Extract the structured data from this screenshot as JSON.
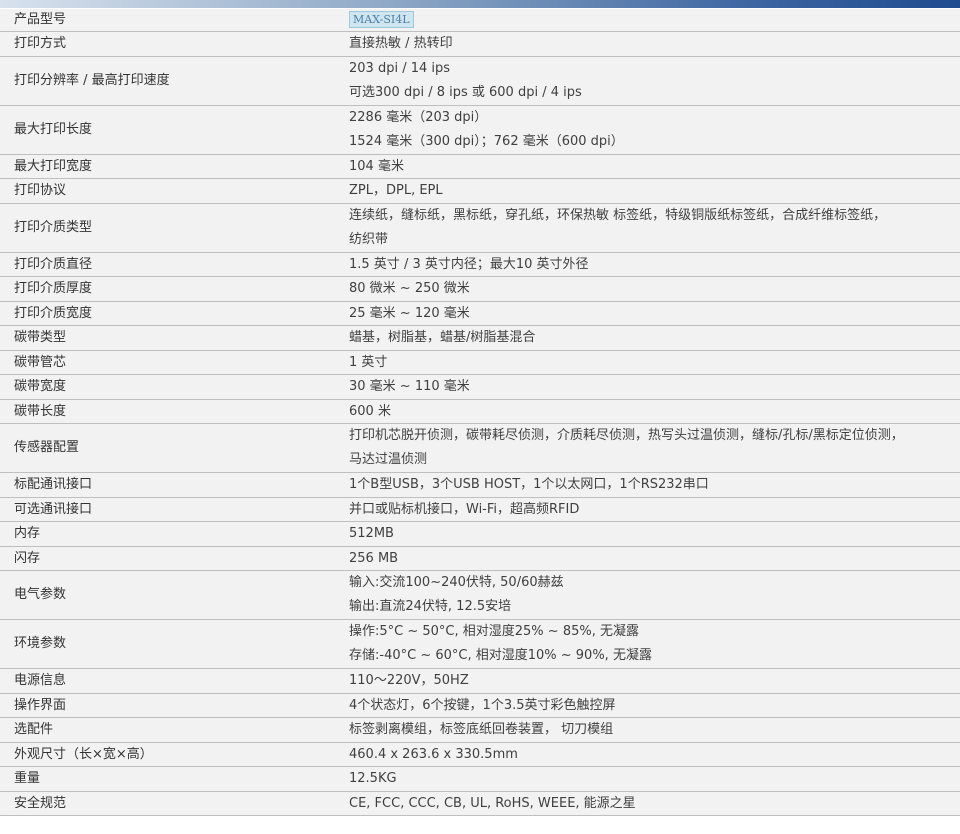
{
  "model_badge": "MAX-SI4L",
  "rows": [
    {
      "label": "产品型号",
      "lines": []
    },
    {
      "label": "打印方式",
      "lines": [
        "直接热敏 / 热转印"
      ]
    },
    {
      "label": "打印分辨率 / 最高打印速度",
      "lines": [
        "203 dpi / 14 ips",
        "可选300 dpi / 8 ips 或 600 dpi / 4 ips"
      ]
    },
    {
      "label": "最大打印长度",
      "lines": [
        "2286 毫米（203 dpi）",
        "1524 毫米（300 dpi）；762 毫米（600 dpi）"
      ]
    },
    {
      "label": "最大打印宽度",
      "lines": [
        "104 毫米"
      ]
    },
    {
      "label": "打印协议",
      "lines": [
        "ZPL，DPL, EPL"
      ]
    },
    {
      "label": "打印介质类型",
      "lines": [
        "连续纸，缝标纸，黑标纸，穿孔纸，环保热敏 标签纸，特级铜版纸标签纸，合成纤维标签纸，",
        "纺织带"
      ]
    },
    {
      "label": "打印介质直径",
      "lines": [
        "1.5 英寸 / 3 英寸内径；最大10 英寸外径"
      ]
    },
    {
      "label": "打印介质厚度",
      "lines": [
        "80 微米 ~ 250 微米"
      ]
    },
    {
      "label": "打印介质宽度",
      "lines": [
        "25 毫米 ~ 120 毫米"
      ]
    },
    {
      "label": "碳带类型",
      "lines": [
        "蜡基，树脂基，蜡基/树脂基混合"
      ]
    },
    {
      "label": "碳带管芯",
      "lines": [
        "1 英寸"
      ]
    },
    {
      "label": "碳带宽度",
      "lines": [
        "30 毫米 ~ 110 毫米"
      ]
    },
    {
      "label": "碳带长度",
      "lines": [
        "600 米"
      ]
    },
    {
      "label": "传感器配置",
      "lines": [
        "打印机芯脱开侦测，碳带耗尽侦测，介质耗尽侦测，热写头过温侦测，缝标/孔标/黑标定位侦测，",
        "马达过温侦测"
      ]
    },
    {
      "label": "标配通讯接口",
      "lines": [
        "1个B型USB，3个USB HOST，1个以太网口，1个RS232串口"
      ]
    },
    {
      "label": "可选通讯接口",
      "lines": [
        "并口或贴标机接口，Wi-Fi，超高频RFID"
      ]
    },
    {
      "label": "内存",
      "lines": [
        "512MB"
      ]
    },
    {
      "label": "闪存",
      "lines": [
        "256 MB"
      ]
    },
    {
      "label": "电气参数",
      "lines": [
        "输入:交流100~240伏特, 50/60赫兹",
        "输出:直流24伏特, 12.5安培"
      ]
    },
    {
      "label": "环境参数",
      "lines": [
        "操作:5°C ~ 50°C, 相对湿度25% ~ 85%, 无凝露",
        "存储:-40°C ~ 60°C, 相对湿度10% ~ 90%, 无凝露"
      ]
    },
    {
      "label": "电源信息",
      "lines": [
        "110～220V，50HZ"
      ]
    },
    {
      "label": "操作界面",
      "lines": [
        "4个状态灯，6个按键，1个3.5英寸彩色触控屏"
      ]
    },
    {
      "label": "选配件",
      "lines": [
        "标签剥离模组，标签底纸回卷装置， 切刀模组"
      ]
    },
    {
      "label": "外观尺寸（长×宽×高）",
      "lines": [
        "460.4 x 263.6 x 330.5mm"
      ]
    },
    {
      "label": "重量",
      "lines": [
        "12.5KG"
      ]
    },
    {
      "label": "安全规范",
      "lines": [
        "CE, FCC, CCC, CB, UL, RoHS, WEEE, 能源之星"
      ]
    }
  ]
}
